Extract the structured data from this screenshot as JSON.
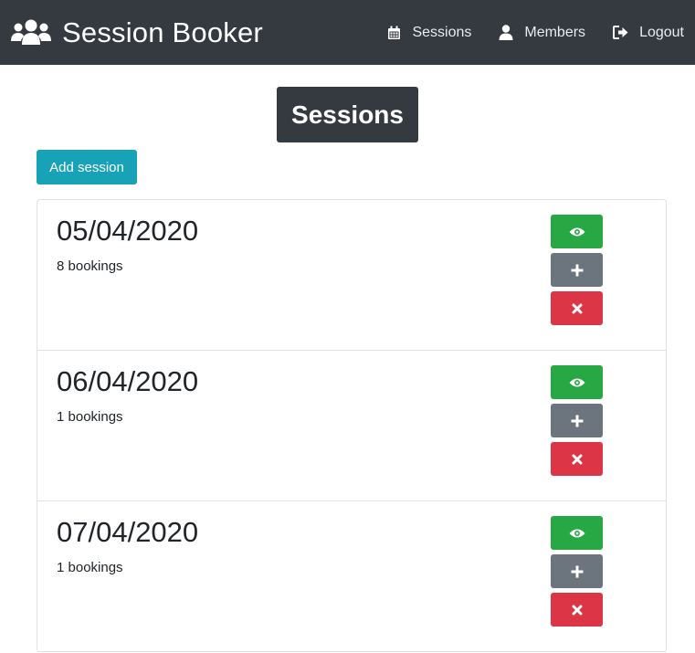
{
  "app": {
    "title": "Session Booker"
  },
  "nav": {
    "items": [
      {
        "label": "Sessions",
        "icon": "calendar-icon"
      },
      {
        "label": "Members",
        "icon": "user-icon"
      },
      {
        "label": "Logout",
        "icon": "logout-icon"
      }
    ]
  },
  "page": {
    "title": "Sessions",
    "add_button": "Add session"
  },
  "sessions": [
    {
      "date": "05/04/2020",
      "bookings": "8 bookings"
    },
    {
      "date": "06/04/2020",
      "bookings": "1 bookings"
    },
    {
      "date": "07/04/2020",
      "bookings": "1 bookings"
    }
  ],
  "actions": {
    "view_icon": "eye-icon",
    "add_icon": "plus-icon",
    "delete_icon": "times-icon"
  },
  "colors": {
    "navbar": "#343a40",
    "info": "#17a2b8",
    "success": "#28a745",
    "secondary": "#6c757d",
    "danger": "#dc3545"
  }
}
